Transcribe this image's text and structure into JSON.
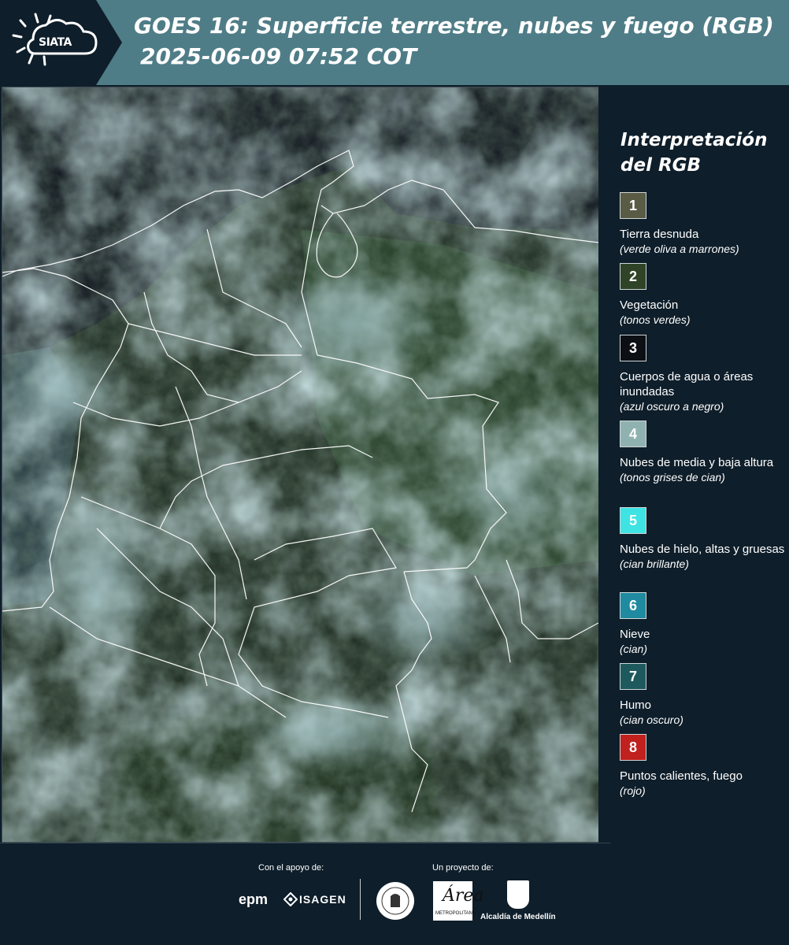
{
  "header": {
    "logo_text": "SIATA",
    "title_line1": "GOES 16: Superficie terrestre, nubes y fuego (RGB)",
    "title_line2": "2025-06-09 07:52 COT"
  },
  "legend": {
    "title_line1": "Interpretación",
    "title_line2": "del RGB",
    "items": [
      {
        "num": "1",
        "color": "#5a5b45",
        "label": "Tierra desnuda",
        "desc": "(verde oliva a marrones)"
      },
      {
        "num": "2",
        "color": "#2f4426",
        "label": "Vegetación",
        "desc": "(tonos verdes)"
      },
      {
        "num": "3",
        "color": "#0c0f14",
        "label": "Cuerpos de agua o áreas inundadas",
        "desc": "(azul oscuro a negro)"
      },
      {
        "num": "4",
        "color": "#8fb2b1",
        "label": "Nubes de media y baja altura",
        "desc": "(tonos grises de cian)"
      },
      {
        "num": "5",
        "color": "#3ee3e3",
        "label": "Nubes de hielo, altas y gruesas",
        "desc": "(cian brillante)"
      },
      {
        "num": "6",
        "color": "#1f8aa0",
        "label": "Nieve",
        "desc": "(cian)"
      },
      {
        "num": "7",
        "color": "#1e5a5d",
        "label": "Humo",
        "desc": "(cian oscuro)"
      },
      {
        "num": "8",
        "color": "#c0201e",
        "label": "Puntos calientes, fuego",
        "desc": "(rojo)"
      }
    ]
  },
  "footer": {
    "support_label": "Con el apoyo de:",
    "project_label": "Un proyecto de:",
    "epm": "epm",
    "isagen": "ISAGEN",
    "area_script": "Área",
    "area_text": "METROPOLITANA",
    "alcaldia": "Alcaldía de Medellín"
  }
}
